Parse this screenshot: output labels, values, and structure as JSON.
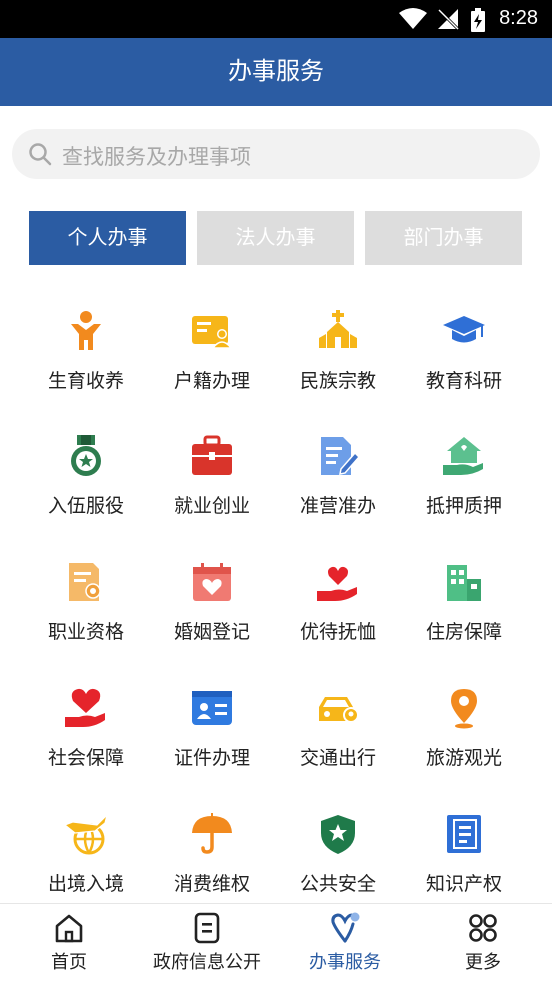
{
  "status_bar": {
    "time": "8:28"
  },
  "header": {
    "title": "办事服务"
  },
  "search": {
    "placeholder": "查找服务及办理事项"
  },
  "tabs": [
    {
      "label": "个人办事",
      "active": true
    },
    {
      "label": "法人办事",
      "active": false
    },
    {
      "label": "部门办事",
      "active": false
    }
  ],
  "services": [
    {
      "label": "生育收养",
      "icon": "person-icon",
      "color": "#f28a1e"
    },
    {
      "label": "户籍办理",
      "icon": "id-card-icon",
      "color": "#f6b619"
    },
    {
      "label": "民族宗教",
      "icon": "church-icon",
      "color": "#f6b619"
    },
    {
      "label": "教育科研",
      "icon": "graduation-cap-icon",
      "color": "#2f6fd6"
    },
    {
      "label": "入伍服役",
      "icon": "medal-icon",
      "color": "#2e7d4f"
    },
    {
      "label": "就业创业",
      "icon": "briefcase-icon",
      "color": "#d9342b"
    },
    {
      "label": "准营准办",
      "icon": "document-edit-icon",
      "color": "#6d9ee8"
    },
    {
      "label": "抵押质押",
      "icon": "house-hand-icon",
      "color": "#5cc08f"
    },
    {
      "label": "职业资格",
      "icon": "certificate-icon",
      "color": "#f5b968"
    },
    {
      "label": "婚姻登记",
      "icon": "heart-calendar-icon",
      "color": "#f07a72"
    },
    {
      "label": "优待抚恤",
      "icon": "heart-hand-icon",
      "color": "#e5242b"
    },
    {
      "label": "住房保障",
      "icon": "buildings-icon",
      "color": "#4fbf86"
    },
    {
      "label": "社会保障",
      "icon": "heart-hand-icon",
      "color": "#e5242b"
    },
    {
      "label": "证件办理",
      "icon": "id-badge-icon",
      "color": "#2f7ae0"
    },
    {
      "label": "交通出行",
      "icon": "car-icon",
      "color": "#f6b619"
    },
    {
      "label": "旅游观光",
      "icon": "location-pin-icon",
      "color": "#f28a1e"
    },
    {
      "label": "出境入境",
      "icon": "plane-globe-icon",
      "color": "#f6b619"
    },
    {
      "label": "消费维权",
      "icon": "umbrella-icon",
      "color": "#f28a1e"
    },
    {
      "label": "公共安全",
      "icon": "shield-star-icon",
      "color": "#1f7a4a"
    },
    {
      "label": "知识产权",
      "icon": "book-icon",
      "color": "#2f6fd6"
    }
  ],
  "bottom_nav": [
    {
      "label": "首页",
      "icon": "home-icon",
      "active": false
    },
    {
      "label": "政府信息公开",
      "icon": "info-list-icon",
      "active": false
    },
    {
      "label": "办事服务",
      "icon": "service-heart-icon",
      "active": true
    },
    {
      "label": "更多",
      "icon": "more-grid-icon",
      "active": false
    }
  ],
  "colors": {
    "primary": "#2b5ca3",
    "tab_inactive": "#dddddd"
  }
}
